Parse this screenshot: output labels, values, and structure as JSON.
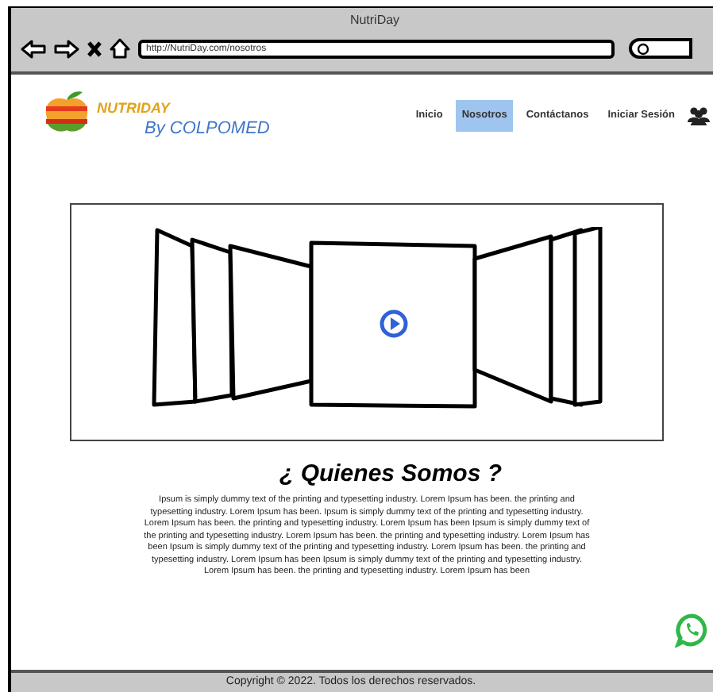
{
  "window": {
    "title": "NutriDay",
    "url": "http://NutriDay.com/nosotros"
  },
  "logo": {
    "name": "NUTRIDAY",
    "tagline": "By COLPOMED"
  },
  "nav": [
    {
      "label": "Inicio",
      "selected": false
    },
    {
      "label": "Nosotros",
      "selected": true
    },
    {
      "label": "Contáctanos",
      "selected": false
    },
    {
      "label": "Iniciar Sesión",
      "selected": false
    }
  ],
  "section": {
    "heading": "¿ Quienes Somos ?",
    "body": "Ipsum is simply dummy text of the printing and typesetting industry. Lorem Ipsum has been. the printing and typesetting industry. Lorem Ipsum has been. Ipsum is simply dummy text of the printing and typesetting industry. Lorem Ipsum has been. the printing and typesetting industry. Lorem Ipsum has been Ipsum is simply dummy text of the printing and typesetting industry. Lorem Ipsum has been. the printing and typesetting industry. Lorem Ipsum has been Ipsum is simply dummy text of the printing and typesetting industry. Lorem Ipsum has been. the printing and typesetting industry. Lorem Ipsum has been Ipsum is simply dummy text of the printing and typesetting industry. Lorem Ipsum has been. the printing and typesetting industry. Lorem Ipsum has been"
  },
  "footer": {
    "copyright": "Copyright © 2022. Todos los derechos reservados."
  }
}
